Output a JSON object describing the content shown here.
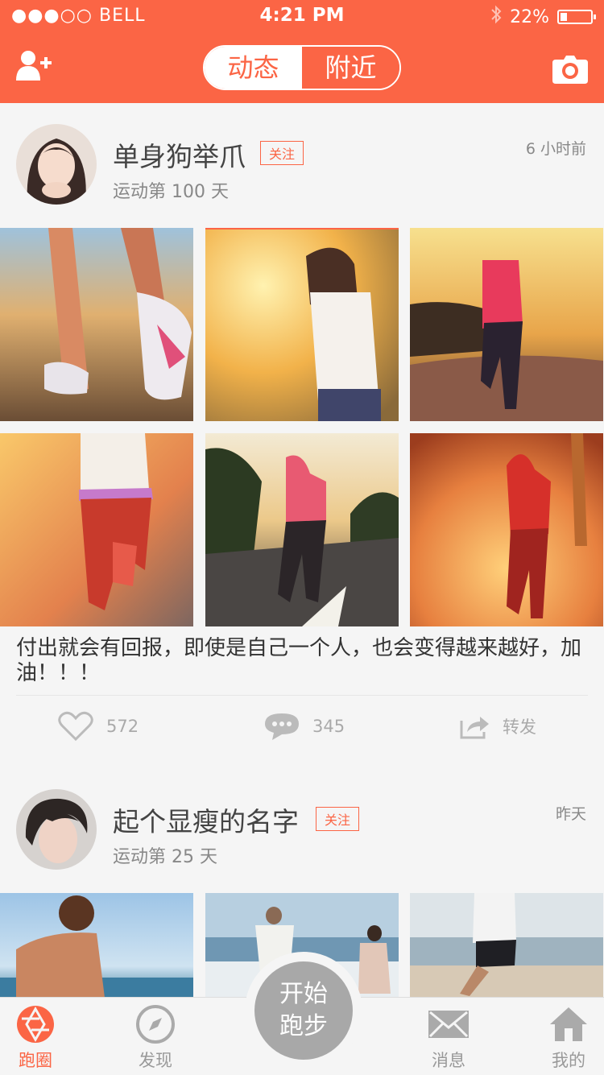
{
  "status_bar": {
    "carrier": "●●●○○ BELL",
    "time": "4:21 PM",
    "battery": "22%",
    "battery_level": 0.22
  },
  "header": {
    "tabs": [
      {
        "label": "动态",
        "active": true
      },
      {
        "label": "附近",
        "active": false
      }
    ]
  },
  "posts": [
    {
      "username": "单身狗举爪",
      "follow_label": "关注",
      "days": "运动第 100 天",
      "time": "6 小时前",
      "caption": "付出就会有回报，即使是自己一个人，也会变得越来越好，加油！！！",
      "likes": "572",
      "comments": "345",
      "share_label": "转发"
    },
    {
      "username": "起个显瘦的名字",
      "follow_label": "关注",
      "days": "运动第 25 天",
      "time": "昨天"
    }
  ],
  "tabbar": {
    "items": [
      {
        "label": "跑圈",
        "icon": "aperture-icon",
        "active": true
      },
      {
        "label": "发现",
        "icon": "compass-icon",
        "active": false
      },
      {
        "label": "消息",
        "icon": "mail-icon",
        "active": false
      },
      {
        "label": "我的",
        "icon": "home-icon",
        "active": false
      }
    ],
    "run_button": "开始跑步"
  },
  "colors": {
    "accent": "#fb6545",
    "background": "#f5f5f5",
    "inactive": "#999999"
  }
}
